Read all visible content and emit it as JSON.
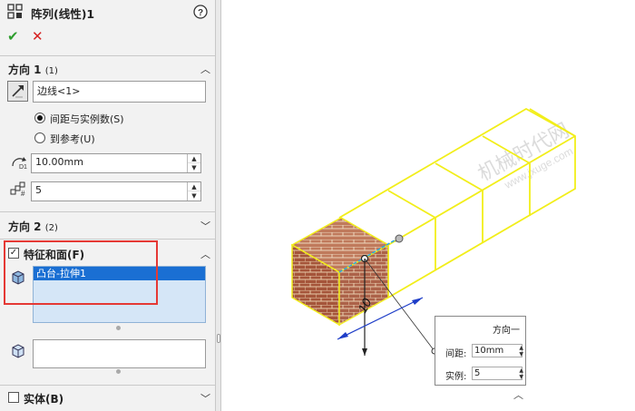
{
  "panel": {
    "title": "阵列(线性)1",
    "ok_symbol": "✔",
    "cancel_symbol": "✕",
    "direction1": {
      "title": "方向 1",
      "hotkey": "(1)",
      "edge_value": "边线<1>",
      "radio_spacing": "间距与实例数(S)",
      "radio_ref": "到参考(U)",
      "spacing_value": "10.00mm",
      "count_value": "5"
    },
    "direction2": {
      "title": "方向 2",
      "hotkey": "(2)"
    },
    "features": {
      "title": "特征和面(F)",
      "item": "凸台-拉伸1"
    },
    "bodies": {
      "title": "实体(B)"
    }
  },
  "viewport": {
    "watermark1": "机械时代网",
    "watermark2": "www.jxuge.com",
    "dim_text": "10",
    "callout": {
      "title": "方向一",
      "spacing_label": "间距:",
      "spacing_value": "10mm",
      "count_label": "实例:",
      "count_value": "5"
    }
  },
  "colors": {
    "accent_blue": "#1a6fd3",
    "highlight_red": "#e53935",
    "preview_yellow": "#f2ee1a",
    "brick": "#a5553a",
    "ok_green": "#2e9e2e",
    "cancel_red": "#d62020"
  }
}
